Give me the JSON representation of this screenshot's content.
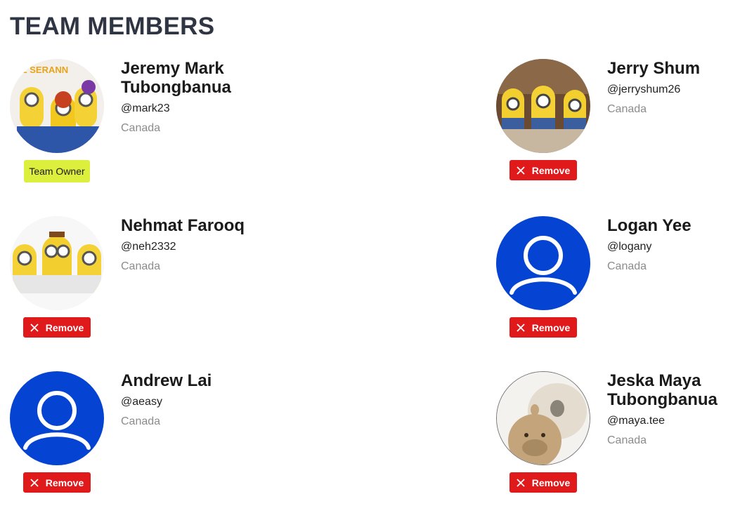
{
  "page": {
    "title": "TEAM MEMBERS"
  },
  "colors": {
    "remove": "#e0191b",
    "owner_badge": "#dcef3c",
    "default_avatar": "#0543d2"
  },
  "members": [
    {
      "name": "Jeremy Mark Tubongbanua",
      "username": "@mark23",
      "country": "Canada",
      "badge": "Team Owner",
      "avatar_icon": "minions-photo-avatar"
    },
    {
      "name": "Jerry Shum",
      "username": "@jerryshum26",
      "country": "Canada",
      "action": "Remove",
      "avatar_icon": "minions-photo-avatar"
    },
    {
      "name": "Nehmat Farooq",
      "username": "@neh2332",
      "country": "Canada",
      "action": "Remove",
      "avatar_icon": "minions-photo-avatar"
    },
    {
      "name": "Logan Yee",
      "username": "@logany",
      "country": "Canada",
      "action": "Remove",
      "avatar_icon": "default-user-icon"
    },
    {
      "name": "Andrew Lai",
      "username": "@aeasy",
      "country": "Canada",
      "action": "Remove",
      "avatar_icon": "default-user-icon"
    },
    {
      "name": "Jeska Maya Tubongbanua",
      "username": "@maya.tee",
      "country": "Canada",
      "action": "Remove",
      "avatar_icon": "capybara-photo-avatar"
    }
  ]
}
